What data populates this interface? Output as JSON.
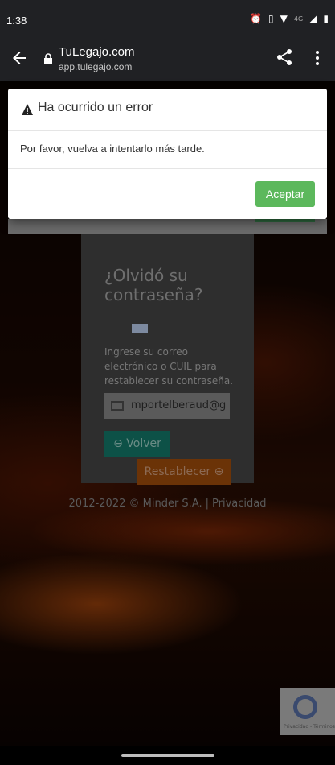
{
  "status_bar": {
    "time": "1:38",
    "network": "4G"
  },
  "browser": {
    "title": "TuLegajo.com",
    "url": "app.tulegajo.com"
  },
  "modal": {
    "title": "Ha ocurrido un error",
    "message": "Por favor, vuelva a intentarlo más tarde.",
    "accept_label": "Aceptar"
  },
  "form": {
    "heading": "¿Olvidó su contraseña?",
    "instructions": "Ingrese su correo electrónico o CUIL para restablecer su contraseña.",
    "email_value": "mportelberaud@g",
    "back_label": "Volver",
    "reset_label": "Restablecer"
  },
  "footer": {
    "copyright": "2012-2022 © Minder S.A.",
    "separator": "|",
    "privacy_link": "Privacidad"
  },
  "recaptcha": {
    "text": "Privacidad - Términos"
  },
  "colors": {
    "accept_button": "#5cb85c",
    "back_button": "#0d5147",
    "reset_button": "#e06a12"
  }
}
